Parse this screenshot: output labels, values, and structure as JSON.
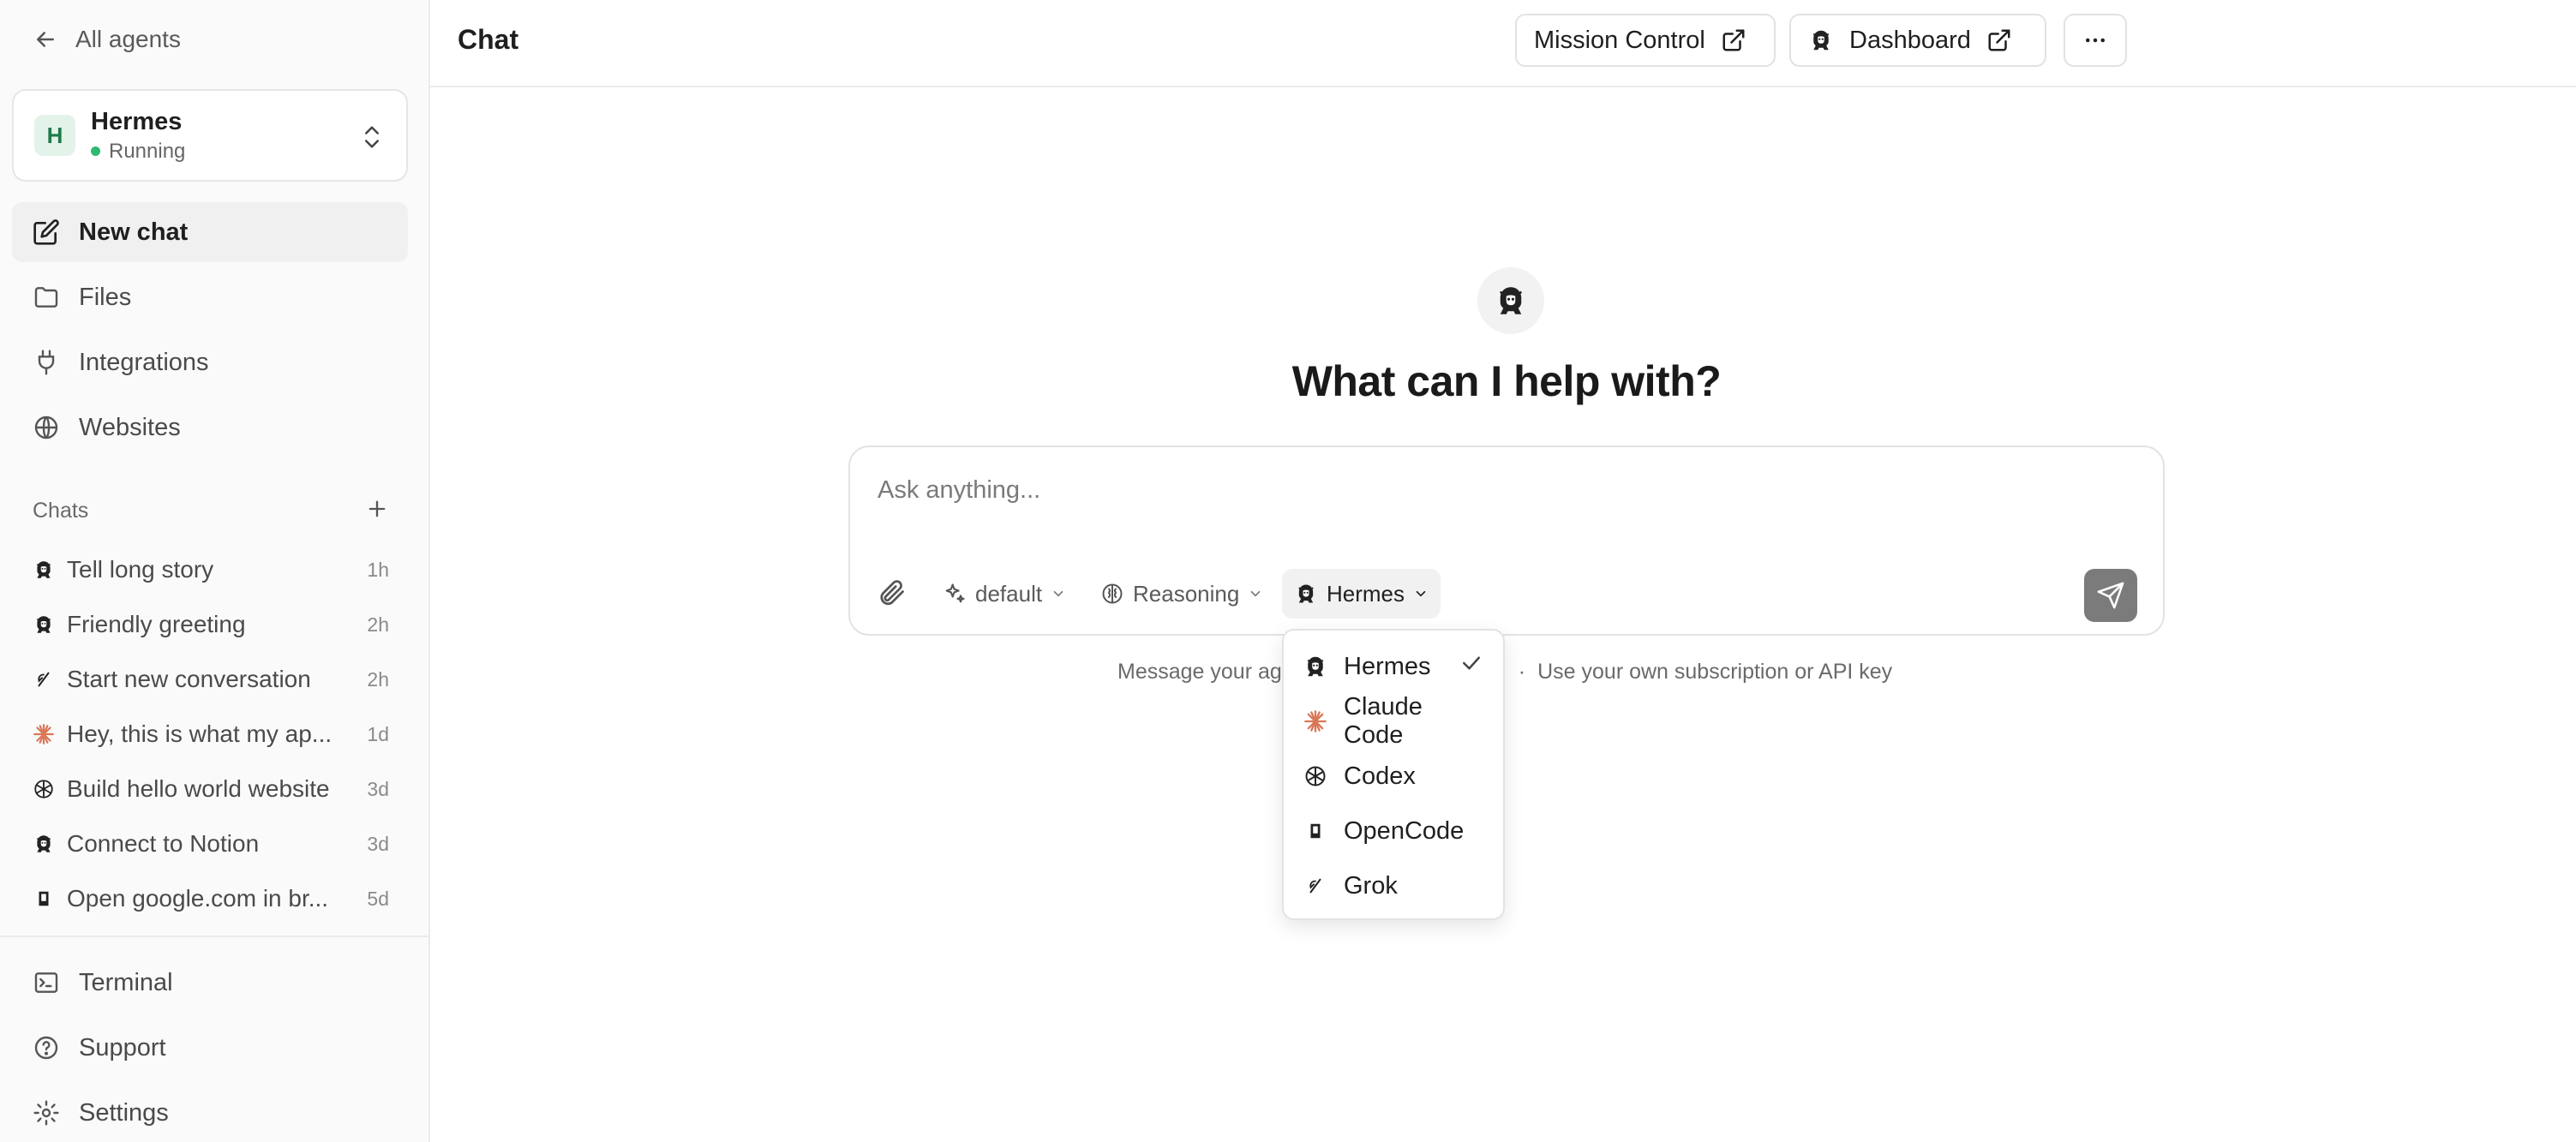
{
  "sidebar": {
    "back_label": "All agents",
    "agent": {
      "initial": "H",
      "name": "Hermes",
      "status": "Running",
      "status_color": "#2eb872"
    },
    "nav": [
      {
        "label": "New chat",
        "icon": "edit-icon",
        "active": true
      },
      {
        "label": "Files",
        "icon": "folder-icon"
      },
      {
        "label": "Integrations",
        "icon": "plug-icon"
      },
      {
        "label": "Websites",
        "icon": "globe-icon"
      }
    ],
    "chats_title": "Chats",
    "chats": [
      {
        "title": "Tell long story",
        "time": "1h",
        "agent": "hermes"
      },
      {
        "title": "Friendly greeting",
        "time": "2h",
        "agent": "hermes"
      },
      {
        "title": "Start new conversation",
        "time": "2h",
        "agent": "grok"
      },
      {
        "title": "Hey, this is what my ap...",
        "time": "1d",
        "agent": "claude"
      },
      {
        "title": "Build hello world website",
        "time": "3d",
        "agent": "codex"
      },
      {
        "title": "Connect to Notion",
        "time": "3d",
        "agent": "hermes"
      },
      {
        "title": "Open google.com in br...",
        "time": "5d",
        "agent": "opencode"
      }
    ],
    "bottom_nav": [
      {
        "label": "Terminal",
        "icon": "terminal-icon"
      },
      {
        "label": "Support",
        "icon": "help-circle-icon"
      },
      {
        "label": "Settings",
        "icon": "gear-icon"
      }
    ]
  },
  "header": {
    "title": "Chat",
    "mission_control_label": "Mission Control",
    "dashboard_label": "Dashboard"
  },
  "main": {
    "hero_title": "What can I help with?",
    "composer": {
      "placeholder": "Ask anything...",
      "mode_label": "default",
      "reasoning_label": "Reasoning",
      "model_label": "Hermes"
    },
    "footer_left": "Message your ag",
    "footer_separator": "·",
    "footer_right": "Use your own subscription or API key"
  },
  "model_dropdown": {
    "items": [
      {
        "label": "Hermes",
        "icon": "hermes-icon",
        "selected": true
      },
      {
        "label": "Claude Code",
        "icon": "claude-icon",
        "selected": false
      },
      {
        "label": "Codex",
        "icon": "codex-icon",
        "selected": false
      },
      {
        "label": "OpenCode",
        "icon": "opencode-icon",
        "selected": false
      },
      {
        "label": "Grok",
        "icon": "grok-icon",
        "selected": false
      }
    ]
  },
  "colors": {
    "accent_green": "#2eb872",
    "claude_orange": "#d97757",
    "send_button": "#7b7b7b"
  }
}
